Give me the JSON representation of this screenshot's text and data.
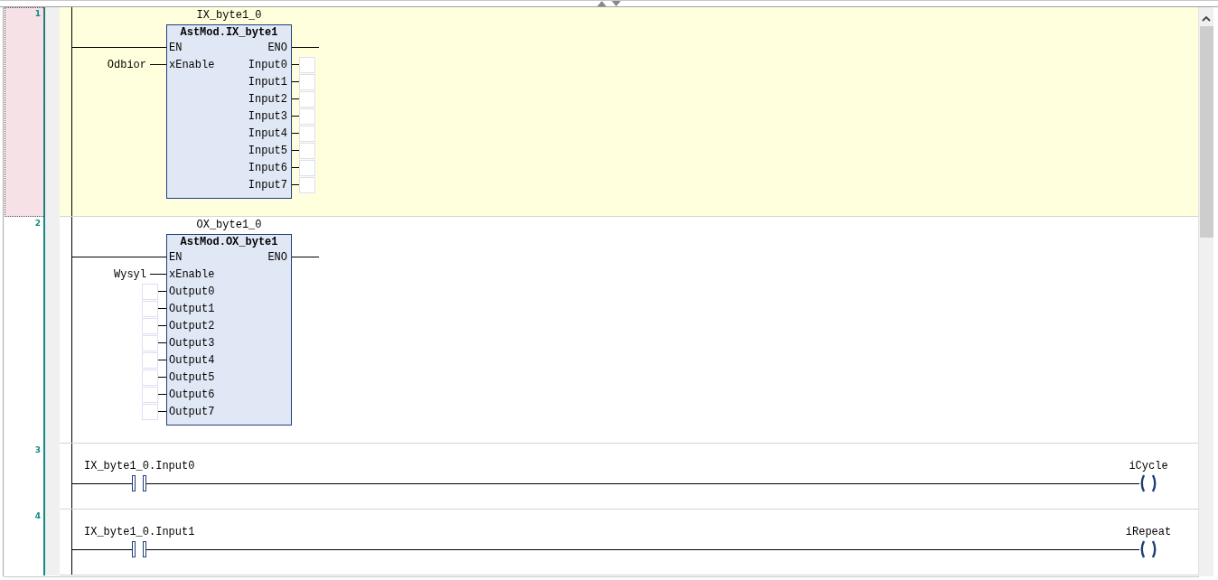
{
  "rungs": [
    {
      "number": "1",
      "selected": true,
      "kind": "function_block",
      "instance": "IX_byte1_0",
      "type": "AstMod.IX_byte1",
      "en": "EN",
      "eno": "ENO",
      "inputs": [
        {
          "pin": "xEnable",
          "variable": "Odbior"
        }
      ],
      "outputs": [
        {
          "pin": "Input0"
        },
        {
          "pin": "Input1"
        },
        {
          "pin": "Input2"
        },
        {
          "pin": "Input3"
        },
        {
          "pin": "Input4"
        },
        {
          "pin": "Input5"
        },
        {
          "pin": "Input6"
        },
        {
          "pin": "Input7"
        }
      ]
    },
    {
      "number": "2",
      "selected": false,
      "kind": "function_block",
      "instance": "OX_byte1_0",
      "type": "AstMod.OX_byte1",
      "en": "EN",
      "eno": "ENO",
      "inputs": [
        {
          "pin": "xEnable",
          "variable": "Wysyl"
        },
        {
          "pin": "Output0"
        },
        {
          "pin": "Output1"
        },
        {
          "pin": "Output2"
        },
        {
          "pin": "Output3"
        },
        {
          "pin": "Output4"
        },
        {
          "pin": "Output5"
        },
        {
          "pin": "Output6"
        },
        {
          "pin": "Output7"
        }
      ]
    },
    {
      "number": "3",
      "selected": false,
      "kind": "contact_coil",
      "contact": "IX_byte1_0.Input0",
      "coil": "iCycle"
    },
    {
      "number": "4",
      "selected": false,
      "kind": "contact_coil",
      "contact": "IX_byte1_0.Input1",
      "coil": "iRepeat"
    }
  ]
}
